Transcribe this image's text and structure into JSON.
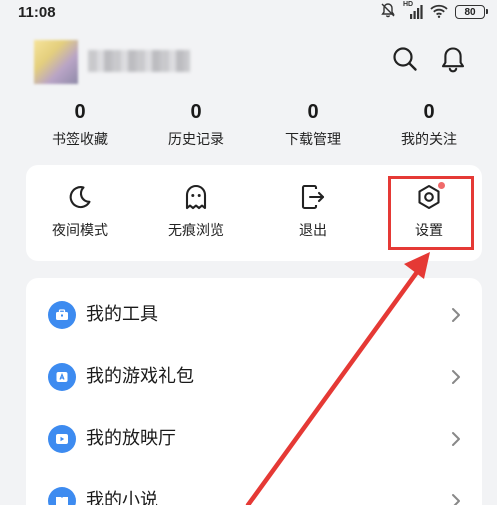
{
  "status_bar": {
    "time": "11:08",
    "network_badge": "HD",
    "battery": "80"
  },
  "header": {
    "avatar": "avatar",
    "username": "blurred-username"
  },
  "stats": [
    {
      "value": "0",
      "label": "书签收藏"
    },
    {
      "value": "0",
      "label": "历史记录"
    },
    {
      "value": "0",
      "label": "下载管理"
    },
    {
      "value": "0",
      "label": "我的关注"
    }
  ],
  "quick_actions": [
    {
      "label": "夜间模式",
      "icon": "moon-icon"
    },
    {
      "label": "无痕浏览",
      "icon": "ghost-icon"
    },
    {
      "label": "退出",
      "icon": "exit-icon"
    },
    {
      "label": "设置",
      "icon": "settings-icon",
      "has_dot": true
    }
  ],
  "menu": [
    {
      "label": "我的工具",
      "icon": "toolbox-icon"
    },
    {
      "label": "我的游戏礼包",
      "icon": "gift-icon"
    },
    {
      "label": "我的放映厅",
      "icon": "play-icon"
    },
    {
      "label": "我的小说",
      "icon": "book-icon"
    }
  ],
  "colors": {
    "background": "#f2f3f5",
    "card": "#ffffff",
    "accent_blue": "#3d8bf0",
    "highlight_red": "#e53935",
    "badge_dot": "#f06a6a"
  }
}
